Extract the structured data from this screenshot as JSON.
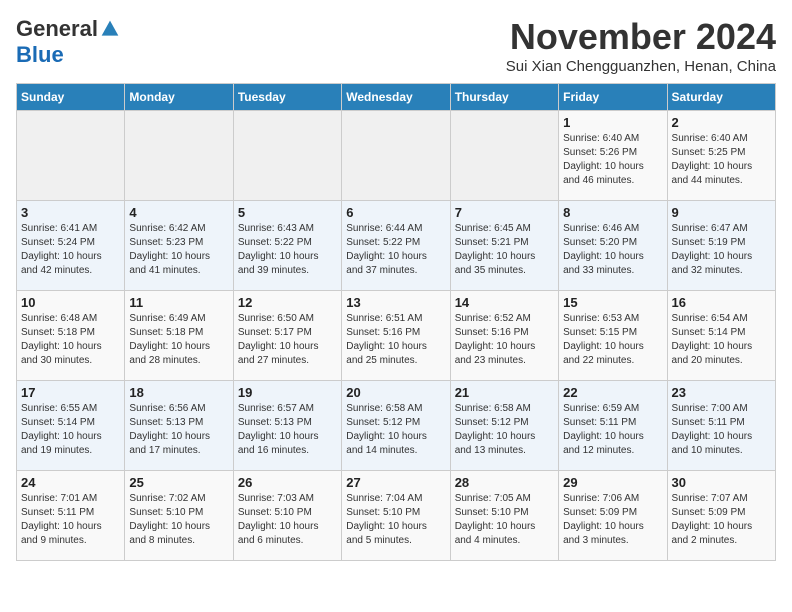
{
  "logo": {
    "general": "General",
    "blue": "Blue"
  },
  "header": {
    "month": "November 2024",
    "location": "Sui Xian Chengguanzhen, Henan, China"
  },
  "weekdays": [
    "Sunday",
    "Monday",
    "Tuesday",
    "Wednesday",
    "Thursday",
    "Friday",
    "Saturday"
  ],
  "weeks": [
    [
      {
        "day": "",
        "sunrise": "",
        "sunset": "",
        "daylight": ""
      },
      {
        "day": "",
        "sunrise": "",
        "sunset": "",
        "daylight": ""
      },
      {
        "day": "",
        "sunrise": "",
        "sunset": "",
        "daylight": ""
      },
      {
        "day": "",
        "sunrise": "",
        "sunset": "",
        "daylight": ""
      },
      {
        "day": "",
        "sunrise": "",
        "sunset": "",
        "daylight": ""
      },
      {
        "day": "1",
        "sunrise": "Sunrise: 6:40 AM",
        "sunset": "Sunset: 5:26 PM",
        "daylight": "Daylight: 10 hours and 46 minutes."
      },
      {
        "day": "2",
        "sunrise": "Sunrise: 6:40 AM",
        "sunset": "Sunset: 5:25 PM",
        "daylight": "Daylight: 10 hours and 44 minutes."
      }
    ],
    [
      {
        "day": "3",
        "sunrise": "Sunrise: 6:41 AM",
        "sunset": "Sunset: 5:24 PM",
        "daylight": "Daylight: 10 hours and 42 minutes."
      },
      {
        "day": "4",
        "sunrise": "Sunrise: 6:42 AM",
        "sunset": "Sunset: 5:23 PM",
        "daylight": "Daylight: 10 hours and 41 minutes."
      },
      {
        "day": "5",
        "sunrise": "Sunrise: 6:43 AM",
        "sunset": "Sunset: 5:22 PM",
        "daylight": "Daylight: 10 hours and 39 minutes."
      },
      {
        "day": "6",
        "sunrise": "Sunrise: 6:44 AM",
        "sunset": "Sunset: 5:22 PM",
        "daylight": "Daylight: 10 hours and 37 minutes."
      },
      {
        "day": "7",
        "sunrise": "Sunrise: 6:45 AM",
        "sunset": "Sunset: 5:21 PM",
        "daylight": "Daylight: 10 hours and 35 minutes."
      },
      {
        "day": "8",
        "sunrise": "Sunrise: 6:46 AM",
        "sunset": "Sunset: 5:20 PM",
        "daylight": "Daylight: 10 hours and 33 minutes."
      },
      {
        "day": "9",
        "sunrise": "Sunrise: 6:47 AM",
        "sunset": "Sunset: 5:19 PM",
        "daylight": "Daylight: 10 hours and 32 minutes."
      }
    ],
    [
      {
        "day": "10",
        "sunrise": "Sunrise: 6:48 AM",
        "sunset": "Sunset: 5:18 PM",
        "daylight": "Daylight: 10 hours and 30 minutes."
      },
      {
        "day": "11",
        "sunrise": "Sunrise: 6:49 AM",
        "sunset": "Sunset: 5:18 PM",
        "daylight": "Daylight: 10 hours and 28 minutes."
      },
      {
        "day": "12",
        "sunrise": "Sunrise: 6:50 AM",
        "sunset": "Sunset: 5:17 PM",
        "daylight": "Daylight: 10 hours and 27 minutes."
      },
      {
        "day": "13",
        "sunrise": "Sunrise: 6:51 AM",
        "sunset": "Sunset: 5:16 PM",
        "daylight": "Daylight: 10 hours and 25 minutes."
      },
      {
        "day": "14",
        "sunrise": "Sunrise: 6:52 AM",
        "sunset": "Sunset: 5:16 PM",
        "daylight": "Daylight: 10 hours and 23 minutes."
      },
      {
        "day": "15",
        "sunrise": "Sunrise: 6:53 AM",
        "sunset": "Sunset: 5:15 PM",
        "daylight": "Daylight: 10 hours and 22 minutes."
      },
      {
        "day": "16",
        "sunrise": "Sunrise: 6:54 AM",
        "sunset": "Sunset: 5:14 PM",
        "daylight": "Daylight: 10 hours and 20 minutes."
      }
    ],
    [
      {
        "day": "17",
        "sunrise": "Sunrise: 6:55 AM",
        "sunset": "Sunset: 5:14 PM",
        "daylight": "Daylight: 10 hours and 19 minutes."
      },
      {
        "day": "18",
        "sunrise": "Sunrise: 6:56 AM",
        "sunset": "Sunset: 5:13 PM",
        "daylight": "Daylight: 10 hours and 17 minutes."
      },
      {
        "day": "19",
        "sunrise": "Sunrise: 6:57 AM",
        "sunset": "Sunset: 5:13 PM",
        "daylight": "Daylight: 10 hours and 16 minutes."
      },
      {
        "day": "20",
        "sunrise": "Sunrise: 6:58 AM",
        "sunset": "Sunset: 5:12 PM",
        "daylight": "Daylight: 10 hours and 14 minutes."
      },
      {
        "day": "21",
        "sunrise": "Sunrise: 6:58 AM",
        "sunset": "Sunset: 5:12 PM",
        "daylight": "Daylight: 10 hours and 13 minutes."
      },
      {
        "day": "22",
        "sunrise": "Sunrise: 6:59 AM",
        "sunset": "Sunset: 5:11 PM",
        "daylight": "Daylight: 10 hours and 12 minutes."
      },
      {
        "day": "23",
        "sunrise": "Sunrise: 7:00 AM",
        "sunset": "Sunset: 5:11 PM",
        "daylight": "Daylight: 10 hours and 10 minutes."
      }
    ],
    [
      {
        "day": "24",
        "sunrise": "Sunrise: 7:01 AM",
        "sunset": "Sunset: 5:11 PM",
        "daylight": "Daylight: 10 hours and 9 minutes."
      },
      {
        "day": "25",
        "sunrise": "Sunrise: 7:02 AM",
        "sunset": "Sunset: 5:10 PM",
        "daylight": "Daylight: 10 hours and 8 minutes."
      },
      {
        "day": "26",
        "sunrise": "Sunrise: 7:03 AM",
        "sunset": "Sunset: 5:10 PM",
        "daylight": "Daylight: 10 hours and 6 minutes."
      },
      {
        "day": "27",
        "sunrise": "Sunrise: 7:04 AM",
        "sunset": "Sunset: 5:10 PM",
        "daylight": "Daylight: 10 hours and 5 minutes."
      },
      {
        "day": "28",
        "sunrise": "Sunrise: 7:05 AM",
        "sunset": "Sunset: 5:10 PM",
        "daylight": "Daylight: 10 hours and 4 minutes."
      },
      {
        "day": "29",
        "sunrise": "Sunrise: 7:06 AM",
        "sunset": "Sunset: 5:09 PM",
        "daylight": "Daylight: 10 hours and 3 minutes."
      },
      {
        "day": "30",
        "sunrise": "Sunrise: 7:07 AM",
        "sunset": "Sunset: 5:09 PM",
        "daylight": "Daylight: 10 hours and 2 minutes."
      }
    ]
  ]
}
